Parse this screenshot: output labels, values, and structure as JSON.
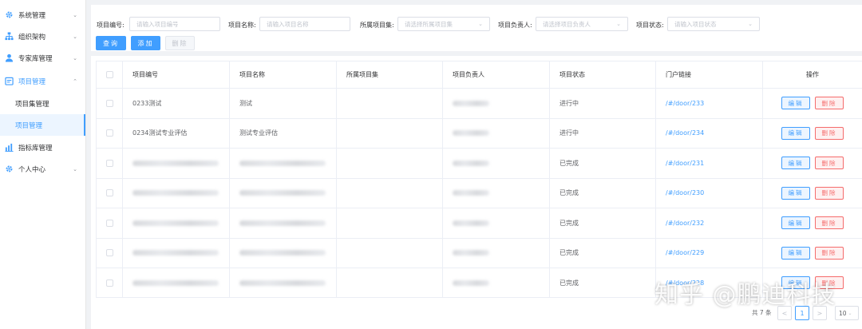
{
  "sidebar": {
    "items": [
      {
        "label": "系统管理",
        "icon": "gear-icon",
        "arrow": "⌄"
      },
      {
        "label": "组织架构",
        "icon": "org-chart-icon",
        "arrow": "⌄"
      },
      {
        "label": "专家库管理",
        "icon": "user-icon",
        "arrow": "⌄"
      },
      {
        "label": "项目管理",
        "icon": "project-icon",
        "arrow": "⌃"
      },
      {
        "label": "项目集管理"
      },
      {
        "label": "项目管理"
      },
      {
        "label": "指标库管理",
        "icon": "bar-chart-icon"
      },
      {
        "label": "个人中心",
        "icon": "gear-icon",
        "arrow": "⌄"
      }
    ]
  },
  "filters": {
    "code_label": "项目编号:",
    "code_placeholder": "请输入项目编号",
    "name_label": "项目名称:",
    "name_placeholder": "请输入项目名称",
    "set_label": "所属项目集:",
    "set_placeholder": "请选择所属项目集",
    "owner_label": "项目负责人:",
    "owner_placeholder": "请选择项目负责人",
    "status_label": "项目状态:",
    "status_placeholder": "请输入项目状态"
  },
  "buttons": {
    "query": "查询",
    "add": "添加",
    "delete": "删除"
  },
  "table": {
    "headers": [
      "项目编号",
      "项目名称",
      "所属项目集",
      "项目负责人",
      "项目状态",
      "门户链接",
      "操作"
    ],
    "rows": [
      {
        "code": "0233测试",
        "name": "测试",
        "status": "进行中",
        "link": "/#/door/233"
      },
      {
        "code": "0234测试专业评估",
        "name": "测试专业评估",
        "status": "进行中",
        "link": "/#/door/234"
      },
      {
        "code": "",
        "name": "",
        "status": "已完成",
        "link": "/#/door/231"
      },
      {
        "code": "",
        "name": "",
        "status": "已完成",
        "link": "/#/door/230"
      },
      {
        "code": "",
        "name": "",
        "status": "已完成",
        "link": "/#/door/232"
      },
      {
        "code": "",
        "name": "",
        "status": "已完成",
        "link": "/#/door/229"
      },
      {
        "code": "",
        "name": "",
        "status": "已完成",
        "link": "/#/door/228"
      }
    ],
    "edit_label": "编辑",
    "delete_label": "删除"
  },
  "pagination": {
    "total": "共 7 条",
    "prev": "<",
    "page": "1",
    "next": ">",
    "page_size": "10"
  },
  "watermark": "知乎 @鹏迪科技",
  "colors": {
    "primary": "#409eff",
    "danger": "#f56c6c",
    "background": "#f0f2f5"
  }
}
